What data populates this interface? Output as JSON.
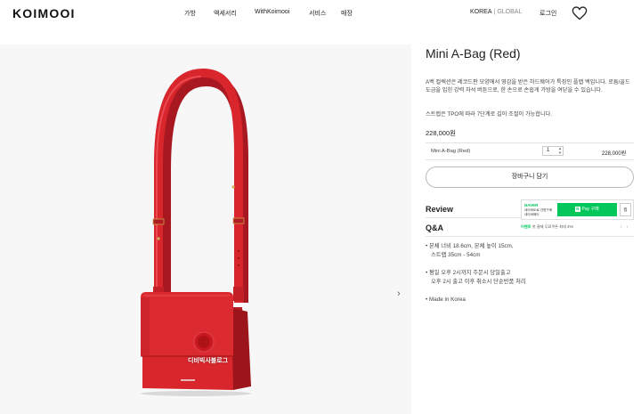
{
  "header": {
    "logo": "KOIMOOI",
    "nav": [
      "가방",
      "액세서리",
      "WithKoimooi",
      "서비스",
      "매장"
    ],
    "region_active": "KOREA",
    "region_separator": "|",
    "region_other": "GLOBAL",
    "login": "로그인"
  },
  "image": {
    "watermark": "디비빅사블로그",
    "next_arrow": "›",
    "bag_color": "#d8262c"
  },
  "product": {
    "title": "Mini A-Bag (Red)",
    "description": "A백 컬렉션은 레코드판 모양에서 영감을 받은 하드웨어가 특징인 플랩 백입니다. 로듐/골드 도금을 입힌 강력 자석 버튼으로, 한 손으로 손쉽게 가방을 여닫을 수 있습니다.",
    "strap_note": "스트랩은 TPO에 따라 7단계로 길이 조절이 가능합니다.",
    "price": "228,000원",
    "option_name": "Mini A-Bag (Red)",
    "quantity": "1",
    "option_price": "228,000원",
    "cart_button": "장바구니 담기",
    "review_label": "Review",
    "qna_label": "Q&A",
    "specs": [
      "• 본체 너비 18.6cm, 본체 높이 15cm,",
      "  스트랩 35cm - 54cm",
      "• 평일 오후 2시까지 주문시 당일출고",
      "  오후 2시 출고 이후 취소시 단순반품 처리",
      "• Made in Korea"
    ]
  },
  "naver_pay": {
    "brand": "NAVER",
    "sub1": "네이버ID로 간편구매",
    "sub2": "네이버페이",
    "pay_badge": "N",
    "pay_label": "Pay 구매",
    "zzim": "찜",
    "event_label": "이벤트",
    "event_text": "첫 결제 무료쿠폰 최대 4%!",
    "arrows": "‹ ›",
    "accent": "#03c75a"
  }
}
